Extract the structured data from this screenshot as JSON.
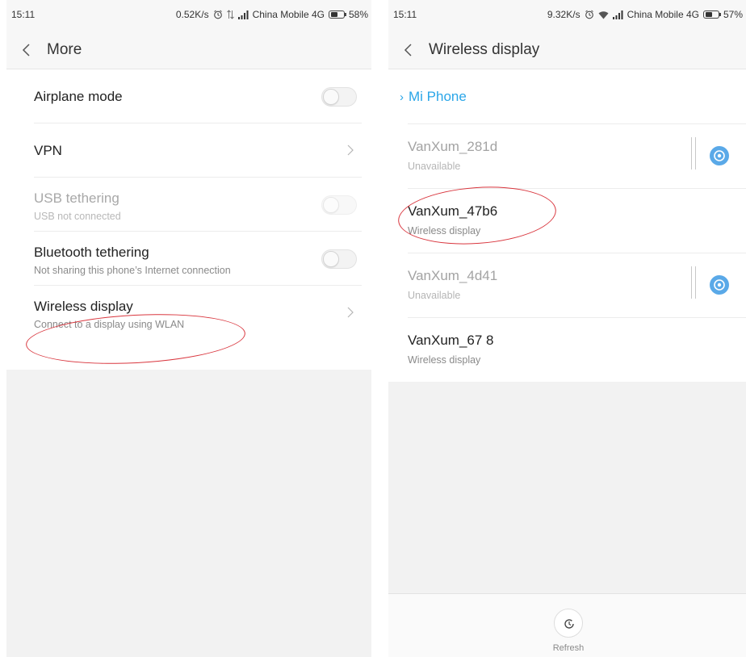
{
  "left": {
    "status": {
      "time": "15:11",
      "speed": "0.52K/s",
      "carrier": "China Mobile 4G",
      "battery": "58%",
      "battery_level": 0.58
    },
    "title": "More",
    "items": [
      {
        "title": "Airplane mode",
        "control": "toggle",
        "on": false,
        "enabled": true
      },
      {
        "title": "VPN",
        "control": "chevron",
        "enabled": true
      },
      {
        "title": "USB tethering",
        "subtitle": "USB not connected",
        "control": "toggle",
        "on": false,
        "enabled": false
      },
      {
        "title": "Bluetooth tethering",
        "subtitle": "Not sharing this phone’s Internet connection",
        "control": "toggle",
        "on": false,
        "enabled": true
      },
      {
        "title": "Wireless display",
        "subtitle": "Connect to a display using WLAN",
        "control": "chevron",
        "enabled": true
      }
    ]
  },
  "right": {
    "status": {
      "time": "15:11",
      "speed": "9.32K/s",
      "carrier": "China Mobile 4G",
      "battery": "57%",
      "battery_level": 0.57
    },
    "title": "Wireless display",
    "section": "Mi Phone",
    "devices": [
      {
        "name": "VanXum_281d",
        "status": "Unavailable",
        "available": false
      },
      {
        "name": "VanXum_47b6",
        "status": "Wireless display",
        "available": true
      },
      {
        "name": "VanXum_4d41",
        "status": "Unavailable",
        "available": false
      },
      {
        "name": "VanXum_67 8",
        "status": "Wireless display",
        "available": true
      }
    ],
    "refresh_label": "Refresh"
  },
  "colors": {
    "accent": "#2aa6e8",
    "highlight": "#d9363e",
    "info_icon": "#5aa9e8"
  },
  "icons": [
    "back-arrow-icon",
    "chevron-right-icon",
    "alarm-icon",
    "data-arrows-icon",
    "wifi-icon",
    "signal-icon",
    "battery-icon",
    "info-icon",
    "refresh-icon"
  ]
}
